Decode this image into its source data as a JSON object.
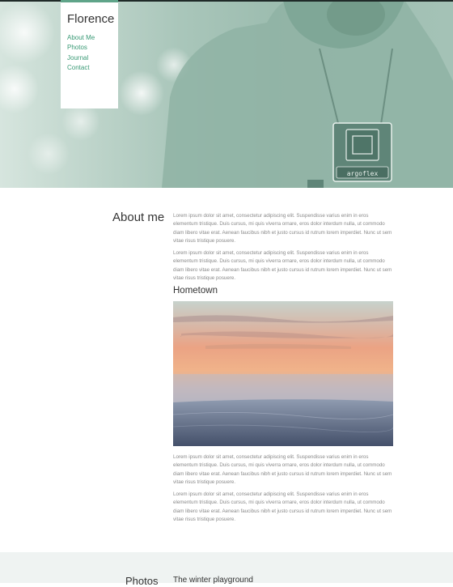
{
  "site": {
    "brand": "Florence",
    "nav": [
      {
        "label": "About Me"
      },
      {
        "label": "Photos"
      },
      {
        "label": "Journal"
      },
      {
        "label": "Contact"
      }
    ]
  },
  "hero": {
    "camera_label": "argoflex"
  },
  "about": {
    "title": "About me",
    "paragraphs": [
      "Lorem ipsum dolor sit amet, consectetur adipiscing elit. Suspendisse varius enim in eros elementum tristique. Duis cursus, mi quis viverra ornare, eros dolor interdum nulla, ut commodo diam libero vitae erat. Aenean faucibus nibh et justo cursus id rutrum lorem imperdiet. Nunc ut sem vitae risus tristique posuere.",
      "Lorem ipsum dolor sit amet, consectetur adipiscing elit. Suspendisse varius enim in eros elementum tristique. Duis cursus, mi quis viverra ornare, eros dolor interdum nulla, ut commodo diam libero vitae erat. Aenean faucibus nibh et justo cursus id rutrum lorem imperdiet. Nunc ut sem vitae risus tristique posuere.",
      "Lorem ipsum dolor sit amet, consectetur adipiscing elit. Suspendisse varius enim in eros elementum tristique. Duis cursus, mi quis viverra ornare, eros dolor interdum nulla, ut commodo diam libero vitae erat. Aenean faucibus nibh et justo cursus id rutrum lorem imperdiet. Nunc ut sem vitae risus tristique posuere.",
      "Lorem ipsum dolor sit amet, consectetur adipiscing elit. Suspendisse varius enim in eros elementum tristique. Duis cursus, mi quis viverra ornare, eros dolor interdum nulla, ut commodo diam libero vitae erat. Aenean faucibus nibh et justo cursus id rutrum lorem imperdiet. Nunc ut sem vitae risus tristique posuere."
    ],
    "hometown_title": "Hometown"
  },
  "photos_section": {
    "title": "Photos",
    "subtitle": "The winter playground"
  },
  "colors": {
    "accent": "#3a9a76",
    "hero_tint": "#9dbdb0",
    "band": "#eff3f2"
  }
}
